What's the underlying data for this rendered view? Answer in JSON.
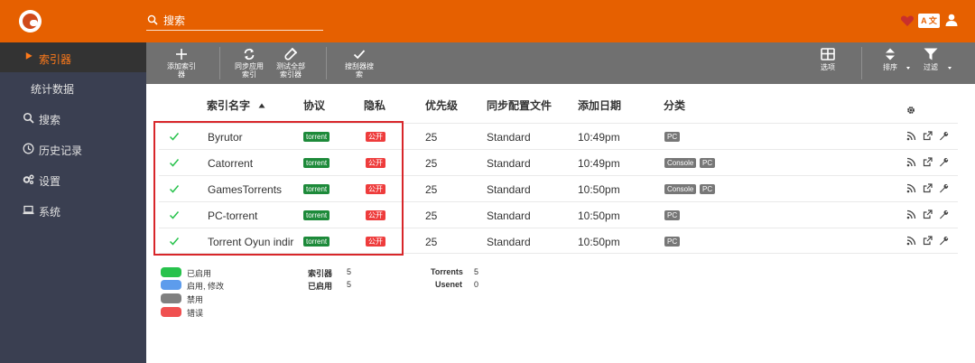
{
  "header": {
    "search_placeholder": "搜索",
    "translate_label": "A 文"
  },
  "sidebar": {
    "items": [
      {
        "label": "索引器",
        "icon": "play-icon",
        "active": true
      },
      {
        "label": "统计数据",
        "icon": "",
        "sub": true
      },
      {
        "label": "搜索",
        "icon": "search-icon"
      },
      {
        "label": "历史记录",
        "icon": "clock-icon"
      },
      {
        "label": "设置",
        "icon": "gears-icon"
      },
      {
        "label": "系统",
        "icon": "laptop-icon"
      }
    ]
  },
  "toolbar": {
    "add_indexer": [
      "添加索引",
      "器"
    ],
    "sync_indexers": [
      "同步应用",
      "索引"
    ],
    "test_all": [
      "测试全部",
      "索引器"
    ],
    "indexer_search": [
      "搜刮器搜",
      "索"
    ],
    "options": "选项",
    "sort": "排序",
    "filter": "过滤"
  },
  "table": {
    "columns": [
      "索引名字",
      "协议",
      "隐私",
      "优先级",
      "同步配置文件",
      "添加日期",
      "分类"
    ],
    "rows": [
      {
        "name": "Byrutor",
        "protocol": "torrent",
        "privacy": "公开",
        "priority": "25",
        "profile": "Standard",
        "added": "10:49pm",
        "categories": [
          "PC"
        ]
      },
      {
        "name": "Catorrent",
        "protocol": "torrent",
        "privacy": "公开",
        "priority": "25",
        "profile": "Standard",
        "added": "10:49pm",
        "categories": [
          "Console",
          "PC"
        ]
      },
      {
        "name": "GamesTorrents",
        "protocol": "torrent",
        "privacy": "公开",
        "priority": "25",
        "profile": "Standard",
        "added": "10:50pm",
        "categories": [
          "Console",
          "PC"
        ]
      },
      {
        "name": "PC-torrent",
        "protocol": "torrent",
        "privacy": "公开",
        "priority": "25",
        "profile": "Standard",
        "added": "10:50pm",
        "categories": [
          "PC"
        ]
      },
      {
        "name": "Torrent Oyun indir",
        "protocol": "torrent",
        "privacy": "公开",
        "priority": "25",
        "profile": "Standard",
        "added": "10:50pm",
        "categories": [
          "PC"
        ]
      }
    ]
  },
  "legend": [
    {
      "label": "已启用",
      "color": "#27c24c"
    },
    {
      "label": "启用, 修改",
      "color": "#5d9cec"
    },
    {
      "label": "禁用",
      "color": "#808080"
    },
    {
      "label": "错误",
      "color": "#f05050"
    }
  ],
  "stats": {
    "indexers_label": "索引器",
    "indexers_value": "5",
    "enabled_label": "已启用",
    "enabled_value": "5",
    "torrents_label": "Torrents",
    "torrents_value": "5",
    "usenet_label": "Usenet",
    "usenet_value": "0"
  },
  "colors": {
    "brand": "#e66000",
    "sidebar": "#3a3f51",
    "toolbar": "#707070",
    "highlight": "#d8262a"
  }
}
